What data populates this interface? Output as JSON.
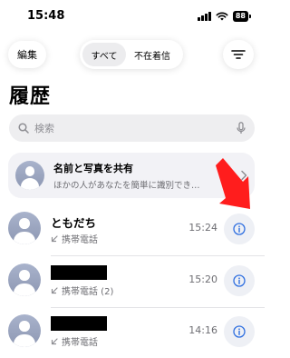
{
  "status_bar": {
    "time": "15:48",
    "battery": "88"
  },
  "header": {
    "edit_label": "編集",
    "filter_tabs": [
      "すべて",
      "不在着信"
    ],
    "filter_icon": "filter-lines-icon"
  },
  "page_title": "履歴",
  "search": {
    "placeholder": "検索"
  },
  "share_card": {
    "title": "名前と写真を共有",
    "subtitle": "ほかの人があなたを簡単に識別でき…"
  },
  "calls": [
    {
      "name": "ともだち",
      "type": "携帯電話",
      "time": "15:24",
      "redacted": false
    },
    {
      "name": "",
      "type": "携帯電話 (2)",
      "time": "15:20",
      "redacted": true
    },
    {
      "name": "",
      "type": "携帯電話",
      "time": "14:16",
      "redacted": true
    }
  ],
  "colors": {
    "accent": "#2f6fe0",
    "annotation_arrow": "#ff1d1d",
    "avatar": "#9aa4bf"
  }
}
